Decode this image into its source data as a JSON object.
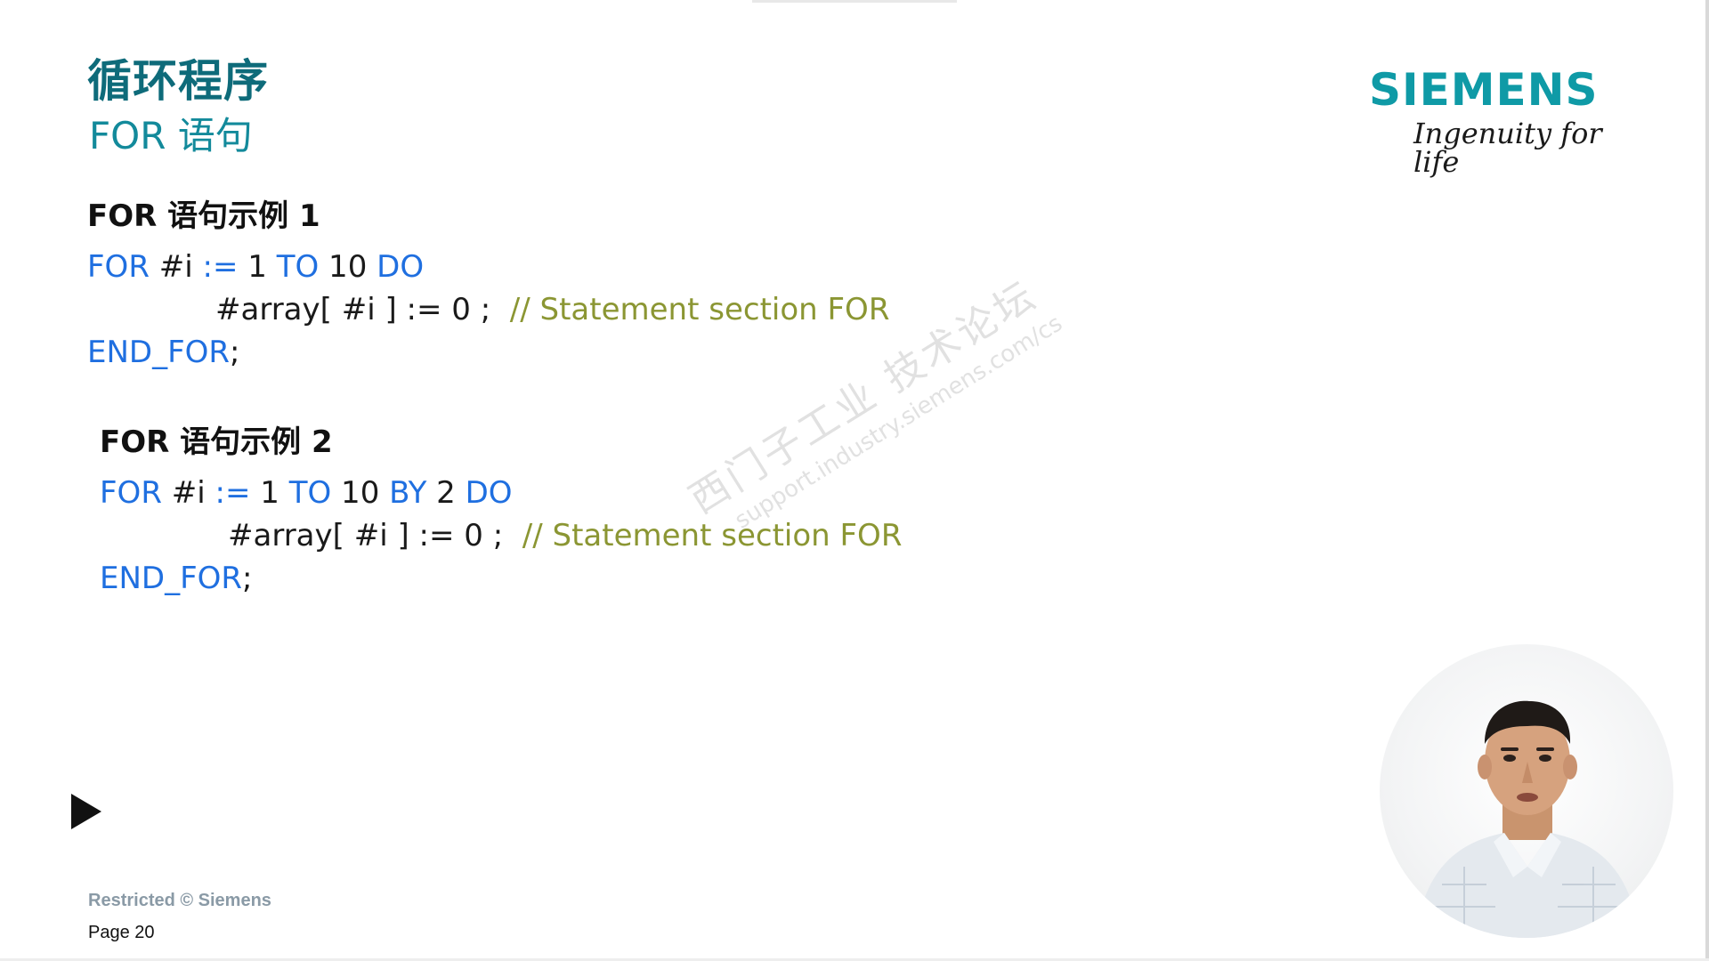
{
  "slide": {
    "title": "循环程序",
    "subtitle": "FOR 语句",
    "logo": {
      "wordmark": "SIEMENS",
      "tagline": "Ingenuity for life",
      "color": "#0f9aa6"
    },
    "examples": [
      {
        "heading": "FOR 语句示例 1",
        "line1": {
          "kw_for": "FOR",
          "var": " #i ",
          "assign": ":=",
          "start": " 1 ",
          "kw_to": "TO",
          "end": " 10 ",
          "kw_do": "DO"
        },
        "line2": {
          "stmt": "#array[ #i ] := 0 ;  ",
          "comment": "// Statement section FOR"
        },
        "line3": {
          "kw_end": "END_FOR",
          "semi": ";"
        }
      },
      {
        "heading": "FOR 语句示例 2",
        "line1": {
          "kw_for": "FOR",
          "var": " #i ",
          "assign": ":=",
          "start": " 1 ",
          "kw_to": "TO",
          "end": " 10 ",
          "kw_by": "BY",
          "step": " 2 ",
          "kw_do": "DO"
        },
        "line2": {
          "stmt": "#array[ #i ] := 0 ;  ",
          "comment": "// Statement section FOR"
        },
        "line3": {
          "kw_end": "END_FOR",
          "semi": ";"
        }
      }
    ],
    "watermark": {
      "main": "西门子工业  技术论坛",
      "url": "support.industry.siemens.com/cs"
    },
    "footer": {
      "restricted": "Restricted © Siemens",
      "page": "Page 20"
    }
  },
  "colors": {
    "title": "#0e6b7a",
    "keyword": "#1f6fe0",
    "comment": "#8b9633",
    "text": "#1a1a1a"
  },
  "icons": {
    "play": "play-icon"
  }
}
